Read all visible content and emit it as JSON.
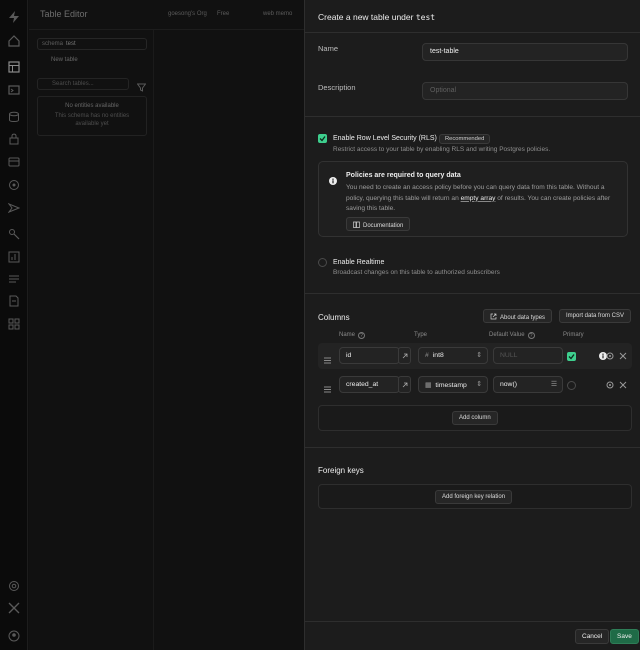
{
  "background": {
    "title": "Table Editor",
    "breadcrumbs": [
      {
        "label": "goesong's Org"
      },
      {
        "label": "Free"
      },
      {
        "label": "web memo"
      }
    ],
    "schema_label": "schema",
    "schema_value": "test",
    "new_table": "New table",
    "search_placeholder": "Search tables...",
    "empty_title": "No entities available",
    "empty_sub": "This schema has no entities available yet"
  },
  "panel": {
    "title_prefix": "Create a new table under",
    "schema": "test",
    "name_label": "Name",
    "name_value": "test-table",
    "description_label": "Description",
    "description_placeholder": "Optional",
    "rls": {
      "title": "Enable Row Level Security (RLS)",
      "badge": "Recommended",
      "subtitle": "Restrict access to your table by enabling RLS and writing Postgres policies."
    },
    "policy": {
      "title": "Policies are required to query data",
      "text_1": "You need to create an access policy before you can query data from this table. Without a policy, querying this table will return an",
      "link": "empty array",
      "text_2": "of results. You can create policies after saving this table.",
      "doc_button": "Documentation"
    },
    "realtime": {
      "title": "Enable Realtime",
      "subtitle": "Broadcast changes on this table to authorized subscribers"
    },
    "columns": {
      "title": "Columns",
      "about_button": "About data types",
      "import_button": "Import data from CSV",
      "headers": {
        "name": "Name",
        "type": "Type",
        "default": "Default Value",
        "primary": "Primary"
      },
      "rows": [
        {
          "name": "id",
          "type": "int8",
          "default": "NULL",
          "primary": true
        },
        {
          "name": "created_at",
          "type": "timestamp",
          "default": "now()",
          "primary": false
        }
      ],
      "add_button": "Add column"
    },
    "foreign_keys": {
      "title": "Foreign keys",
      "add_button": "Add foreign key relation"
    },
    "footer": {
      "cancel": "Cancel",
      "save": "Save"
    }
  },
  "colors": {
    "accent": "#3ecf8e",
    "save": "#1f6b47",
    "panel": "#1c1c1c"
  }
}
